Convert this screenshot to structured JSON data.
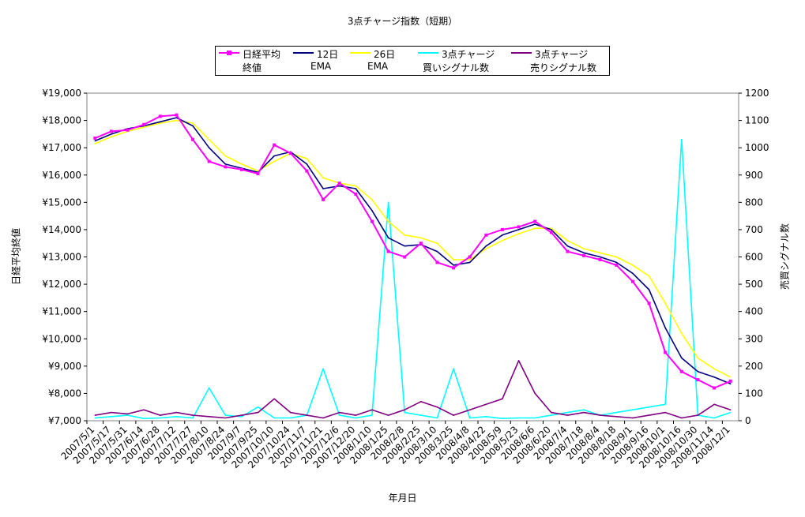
{
  "chart_data": {
    "type": "line",
    "title": "3点チャージ指数（短期）",
    "xlabel": "年月日",
    "ylabel_left": "日経平均終値",
    "ylabel_right": "売買シグナル数",
    "y_left_ticks": [
      "¥7,000",
      "¥8,000",
      "¥9,000",
      "¥10,000",
      "¥11,000",
      "¥12,000",
      "¥13,000",
      "¥14,000",
      "¥15,000",
      "¥16,000",
      "¥17,000",
      "¥18,000",
      "¥19,000"
    ],
    "y_right_ticks": [
      "0",
      "100",
      "200",
      "300",
      "400",
      "500",
      "600",
      "700",
      "800",
      "900",
      "1000",
      "1100",
      "1200"
    ],
    "ylim_left": [
      7000,
      19000
    ],
    "ylim_right": [
      0,
      1200
    ],
    "grid": false,
    "legend_position": "top",
    "categories": [
      "2007/5/1",
      "2007/5/17",
      "2007/5/31",
      "2007/6/14",
      "2007/6/28",
      "2007/7/12",
      "2007/7/27",
      "2007/8/10",
      "2007/8/24",
      "2007/9/7",
      "2007/9/25",
      "2007/10/10",
      "2007/10/24",
      "2007/11/7",
      "2007/11/21",
      "2007/12/6",
      "2007/12/20",
      "2008/1/10",
      "2008/1/25",
      "2008/2/8",
      "2008/2/25",
      "2008/3/10",
      "2008/3/25",
      "2008/4/8",
      "2008/4/22",
      "2008/5/9",
      "2008/5/23",
      "2008/6/6",
      "2008/6/20",
      "2008/7/4",
      "2008/7/18",
      "2008/8/4",
      "2008/8/18",
      "2008/9/1",
      "2008/9/16",
      "2008/10/1",
      "2008/10/16",
      "2008/10/30",
      "2008/11/14",
      "2008/12/1"
    ],
    "series": [
      {
        "name": "日経平均終値",
        "axis": "left",
        "color": "#ff00ff",
        "values": [
          17350,
          17600,
          17650,
          17850,
          18150,
          18200,
          17300,
          16500,
          16300,
          16200,
          16050,
          17100,
          16800,
          16150,
          15100,
          15700,
          15300,
          14300,
          13200,
          13000,
          13500,
          12800,
          12600,
          13000,
          13800,
          14000,
          14100,
          14300,
          13900,
          13200,
          13050,
          12900,
          12700,
          12100,
          11300,
          9500,
          8800,
          8500,
          8200,
          8450
        ]
      },
      {
        "name": "12日EMA",
        "axis": "left",
        "color": "#000080",
        "values": [
          17250,
          17500,
          17700,
          17800,
          17950,
          18100,
          17800,
          17000,
          16400,
          16250,
          16100,
          16700,
          16850,
          16400,
          15500,
          15600,
          15500,
          14700,
          13700,
          13400,
          13450,
          13200,
          12700,
          12800,
          13400,
          13800,
          14000,
          14200,
          14000,
          13400,
          13150,
          13000,
          12800,
          12400,
          11800,
          10400,
          9300,
          8800,
          8600,
          8350
        ]
      },
      {
        "name": "26日EMA",
        "axis": "left",
        "color": "#ffff00",
        "values": [
          17150,
          17400,
          17600,
          17750,
          17900,
          18000,
          17900,
          17300,
          16700,
          16400,
          16150,
          16500,
          16800,
          16600,
          15900,
          15700,
          15600,
          15100,
          14300,
          13800,
          13700,
          13500,
          12900,
          12900,
          13300,
          13600,
          13850,
          14050,
          14050,
          13600,
          13300,
          13150,
          13000,
          12700,
          12300,
          11300,
          10200,
          9300,
          8900,
          8600
        ]
      },
      {
        "name": "3点チャージ買いシグナル数",
        "axis": "right",
        "color": "#00ffff",
        "values": [
          10,
          15,
          20,
          8,
          10,
          15,
          10,
          120,
          20,
          15,
          50,
          10,
          10,
          20,
          190,
          20,
          10,
          20,
          800,
          30,
          20,
          10,
          190,
          10,
          15,
          8,
          10,
          10,
          20,
          30,
          40,
          20,
          30,
          40,
          50,
          60,
          1030,
          20,
          10,
          30
        ]
      },
      {
        "name": "3点チャージ売りシグナル数",
        "axis": "right",
        "color": "#800080",
        "values": [
          20,
          30,
          25,
          40,
          20,
          30,
          20,
          15,
          10,
          20,
          30,
          80,
          30,
          20,
          10,
          30,
          20,
          40,
          20,
          40,
          70,
          50,
          20,
          40,
          60,
          80,
          220,
          100,
          30,
          20,
          30,
          20,
          15,
          10,
          20,
          30,
          10,
          20,
          60,
          40
        ]
      }
    ]
  },
  "legend": [
    {
      "line1": "日経平均",
      "line2": "終値",
      "color": "#ff00ff",
      "marker": true
    },
    {
      "line1": "12日",
      "line2": "EMA",
      "color": "#000080",
      "marker": false
    },
    {
      "line1": "26日",
      "line2": "EMA",
      "color": "#ffff00",
      "marker": false
    },
    {
      "line1": "3点チャージ",
      "line2": "買いシグナル数",
      "color": "#00ffff",
      "marker": false
    },
    {
      "line1": "3点チャージ",
      "line2": "売りシグナル数",
      "color": "#800080",
      "marker": false
    }
  ]
}
